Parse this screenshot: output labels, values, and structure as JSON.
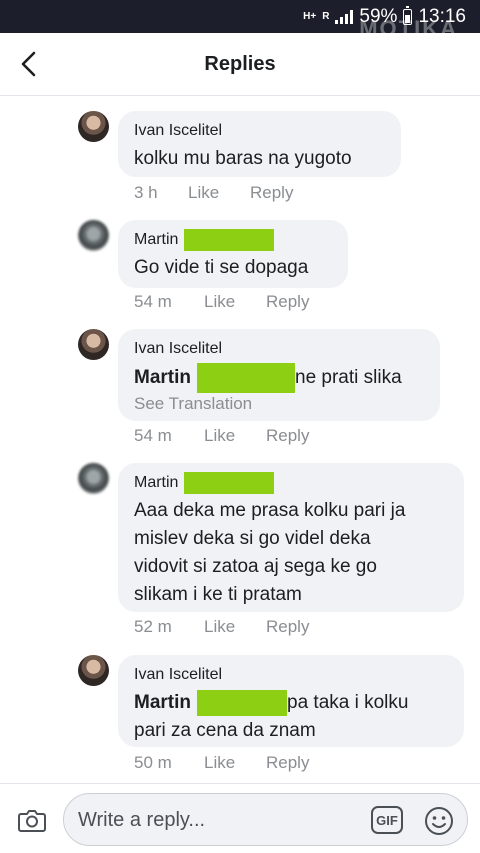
{
  "status_bar": {
    "network": "H+",
    "network_sub": "R",
    "battery": "59%",
    "time": "13:16",
    "watermark": "MOTIKA"
  },
  "header": {
    "title": "Replies"
  },
  "comments": [
    {
      "author": "Ivan Iscelitel",
      "text": "kolku mu baras na yugoto",
      "time": "3 h",
      "like": "Like",
      "reply": "Reply"
    },
    {
      "author": "Martin",
      "text": "Go vide ti se dopaga",
      "time": "54 m",
      "like": "Like",
      "reply": "Reply"
    },
    {
      "author": "Ivan Iscelitel",
      "mention": "Martin",
      "text": "ne prati slika",
      "see_translation": "See Translation",
      "time": "54 m",
      "like": "Like",
      "reply": "Reply"
    },
    {
      "author": "Martin",
      "text_lines": [
        "Aaa deka me prasa kolku pari ja",
        "mislev deka si go videl deka",
        "vidovit si zatoa aj sega ke go",
        "slikam i ke ti pratam"
      ],
      "time": "52 m",
      "like": "Like",
      "reply": "Reply"
    },
    {
      "author": "Ivan Iscelitel",
      "mention": "Martin",
      "text_first": "pa taka i kolku",
      "text_second": "pari za cena da znam",
      "time": "50 m",
      "like": "Like",
      "reply": "Reply"
    }
  ],
  "composer": {
    "placeholder": "Write a reply...",
    "gif_label": "GIF"
  },
  "colors": {
    "redaction": "#8dd013",
    "bubble": "#f0f2f5",
    "meta": "#8a8d91"
  }
}
